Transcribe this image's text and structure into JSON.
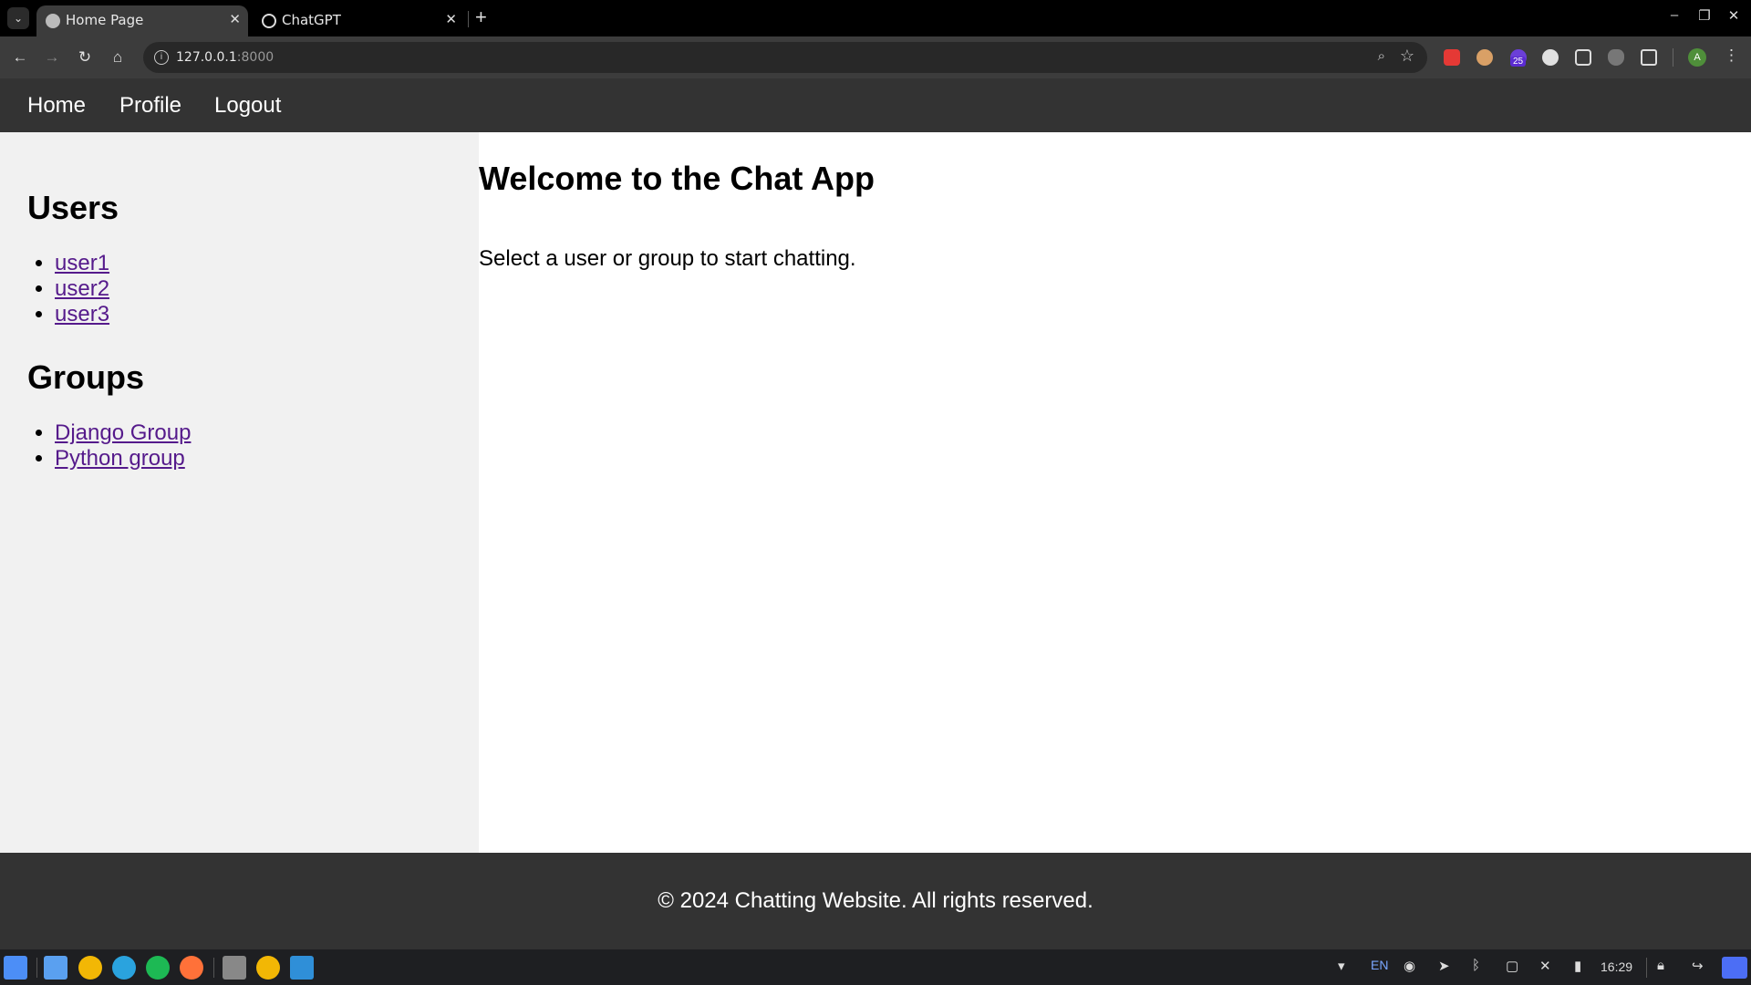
{
  "browser": {
    "tabs": [
      {
        "title": "Home Page",
        "active": true
      },
      {
        "title": "ChatGPT",
        "active": false
      }
    ],
    "address": {
      "host": "127.0.0.1",
      "port": ":8000"
    },
    "profile_initial": "A",
    "extension_badge": "25"
  },
  "nav": {
    "home": "Home",
    "profile": "Profile",
    "logout": "Logout"
  },
  "sidebar": {
    "users_heading": "Users",
    "users": [
      "user1",
      "user2",
      "user3"
    ],
    "groups_heading": "Groups",
    "groups": [
      "Django Group",
      "Python group"
    ]
  },
  "main": {
    "title": "Welcome to the Chat App",
    "subtitle": "Select a user or group to start chatting."
  },
  "footer": {
    "text": "© 2024 Chatting Website. All rights reserved."
  },
  "taskbar": {
    "language": "EN",
    "clock": "16:29"
  },
  "colors": {
    "nav_bg": "#333333",
    "sidebar_bg": "#f1f1f1",
    "link_visited": "#551a8b"
  }
}
